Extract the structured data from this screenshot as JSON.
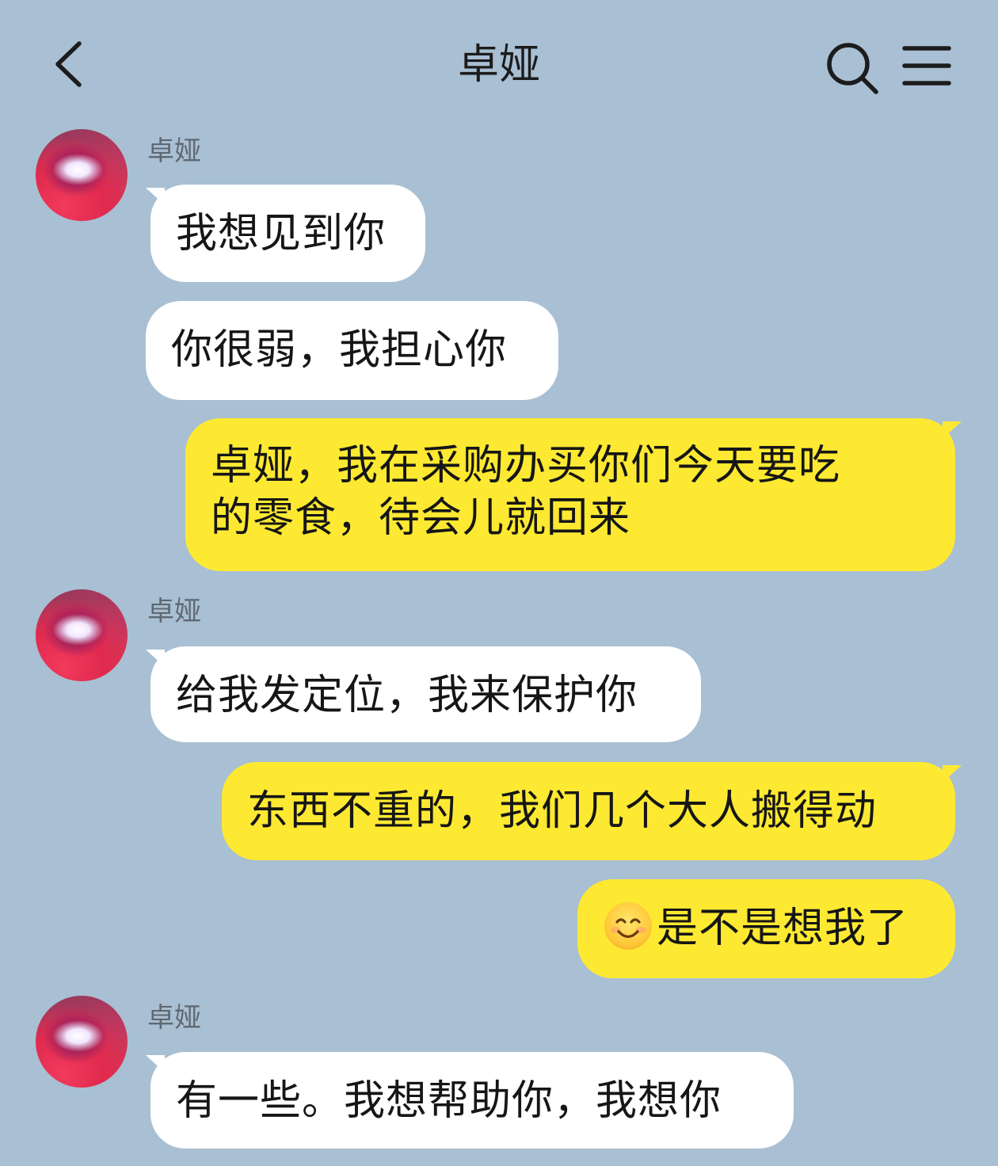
{
  "header": {
    "title": "卓娅",
    "back_icon": "chevron-left-icon",
    "search_icon": "search-icon",
    "menu_icon": "menu-icon"
  },
  "colors": {
    "background": "#a9bfd3",
    "incoming_bubble": "#ffffff",
    "outgoing_bubble": "#fde932"
  },
  "messages": [
    {
      "direction": "in",
      "sender": "卓娅",
      "text": "我想见到你"
    },
    {
      "direction": "in",
      "text": "你很弱，我担心你"
    },
    {
      "direction": "out",
      "line1": "卓娅，我在采购办买你们今天要吃",
      "line2": "的零食，待会儿就回来"
    },
    {
      "direction": "in",
      "sender": "卓娅",
      "text": "给我发定位，我来保护你"
    },
    {
      "direction": "out",
      "text": "东西不重的，我们几个大人搬得动"
    },
    {
      "direction": "out",
      "emoji": "smiling-face-emoji",
      "text": "是不是想我了"
    },
    {
      "direction": "in",
      "sender": "卓娅",
      "text": "有一些。我想帮助你，我想你"
    }
  ]
}
